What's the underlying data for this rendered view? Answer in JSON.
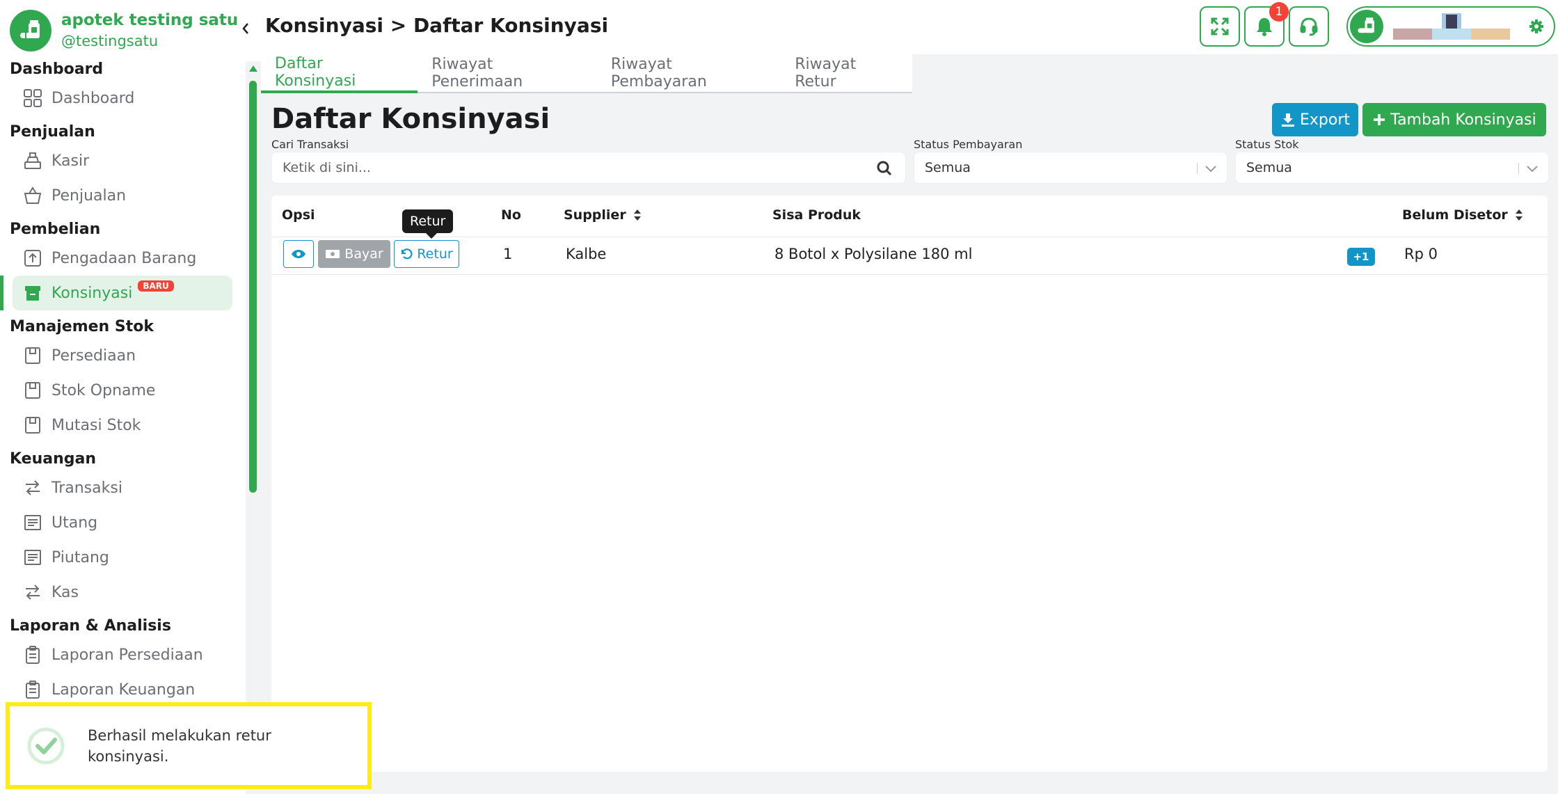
{
  "brand": {
    "name": "apotek testing satu",
    "handle": "@testingsatu"
  },
  "nav": {
    "dashboard_title": "Dashboard",
    "dashboard": "Dashboard",
    "penjualan_title": "Penjualan",
    "kasir": "Kasir",
    "penjualan": "Penjualan",
    "pembelian_title": "Pembelian",
    "pengadaan": "Pengadaan Barang",
    "konsinyasi": "Konsinyasi",
    "konsinyasi_badge": "BARU",
    "stok_title": "Manajemen Stok",
    "persediaan": "Persediaan",
    "opname": "Stok Opname",
    "mutasi": "Mutasi Stok",
    "keuangan_title": "Keuangan",
    "transaksi": "Transaksi",
    "utang": "Utang",
    "piutang": "Piutang",
    "kas": "Kas",
    "laporan_title": "Laporan & Analisis",
    "lap_persediaan": "Laporan Persediaan",
    "lap_keuangan": "Laporan Keuangan"
  },
  "header": {
    "breadcrumb": "Konsinyasi > Daftar Konsinyasi",
    "notif_count": "1"
  },
  "tabs": [
    "Daftar Konsinyasi",
    "Riwayat Penerimaan",
    "Riwayat Pembayaran",
    "Riwayat Retur"
  ],
  "content": {
    "title": "Daftar Konsinyasi",
    "export_label": "Export",
    "add_label": "Tambah Konsinyasi"
  },
  "filters": {
    "search_label": "Cari Transaksi",
    "search_placeholder": "Ketik di sini...",
    "payment_label": "Status Pembayaran",
    "payment_value": "Semua",
    "stock_label": "Status Stok",
    "stock_value": "Semua"
  },
  "table": {
    "headers": {
      "opsi": "Opsi",
      "no": "No",
      "supplier": "Supplier",
      "sisa": "Sisa Produk",
      "belum": "Belum Disetor"
    },
    "rows": [
      {
        "no": "1",
        "supplier": "Kalbe",
        "sisa": "8 Botol x Polysilane 180 ml",
        "more": "+1",
        "belum": "Rp 0"
      }
    ],
    "pay_label": "Bayar",
    "retur_label": "Retur",
    "tooltip": "Retur"
  },
  "toast": {
    "message": "Berhasil melakukan retur konsinyasi."
  },
  "colors": {
    "brand_green": "#2fa84f",
    "info_blue": "#1196c7",
    "danger_red": "#f44336",
    "toast_border": "#ffeb1a"
  }
}
